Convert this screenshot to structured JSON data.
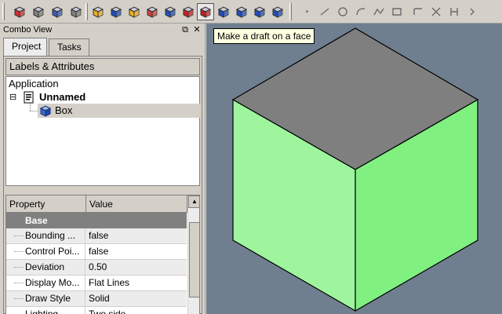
{
  "toolbar": {
    "tools": [
      {
        "name": "new-document-icon",
        "color": "#d03030"
      },
      {
        "name": "open-icon",
        "color": "#808080"
      },
      {
        "name": "save-icon",
        "color": "#3a5fb0"
      },
      {
        "name": "export-icon",
        "color": "#808080"
      },
      {
        "name": "pad-icon",
        "color": "#e8b020"
      },
      {
        "name": "pocket-icon",
        "color": "#2050c0"
      },
      {
        "name": "revolution-icon",
        "color": "#f0b020"
      },
      {
        "name": "groove-icon",
        "color": "#d04040"
      },
      {
        "name": "fillet-icon",
        "color": "#2050c0"
      },
      {
        "name": "chamfer-icon",
        "color": "#d02020"
      },
      {
        "name": "draft-icon",
        "color": "#c02020"
      },
      {
        "name": "mirrored-icon",
        "color": "#2050c0"
      },
      {
        "name": "linear-pattern-icon",
        "color": "#2050c0"
      },
      {
        "name": "polar-pattern-icon",
        "color": "#2050c0"
      },
      {
        "name": "multitransform-icon",
        "color": "#2050c0"
      }
    ],
    "sketch_tools": [
      "point-icon",
      "line-icon",
      "circle-icon",
      "arc-icon",
      "polyline-icon",
      "rectangle-icon",
      "fillet-sketch-icon",
      "trim-icon",
      "constraint-icon",
      "more-icon"
    ]
  },
  "combo": {
    "title": "Combo View",
    "float_symbol": "⧉",
    "close_symbol": "✕",
    "tabs": [
      "Project",
      "Tasks"
    ],
    "labels_header": "Labels & Attributes",
    "tree": {
      "root": "Application",
      "document": "Unnamed",
      "expand_symbol": "⊟",
      "child": "Box"
    },
    "properties": {
      "header_property": "Property",
      "header_value": "Value",
      "group": "Base",
      "rows": [
        {
          "name": "Bounding ...",
          "value": "false"
        },
        {
          "name": "Control Poi...",
          "value": "false"
        },
        {
          "name": "Deviation",
          "value": "0.50"
        },
        {
          "name": "Display Mo...",
          "value": "Flat Lines"
        },
        {
          "name": "Draw Style",
          "value": "Solid"
        },
        {
          "name": "Lighting",
          "value": "Two side"
        }
      ]
    }
  },
  "view": {
    "tooltip": "Make a draft on a face",
    "background": "#6f7f8f",
    "cube_top_color": "#7f7f7f",
    "cube_left_color": "#9ef59e",
    "cube_right_color": "#80f080",
    "edge_color": "#000000"
  }
}
